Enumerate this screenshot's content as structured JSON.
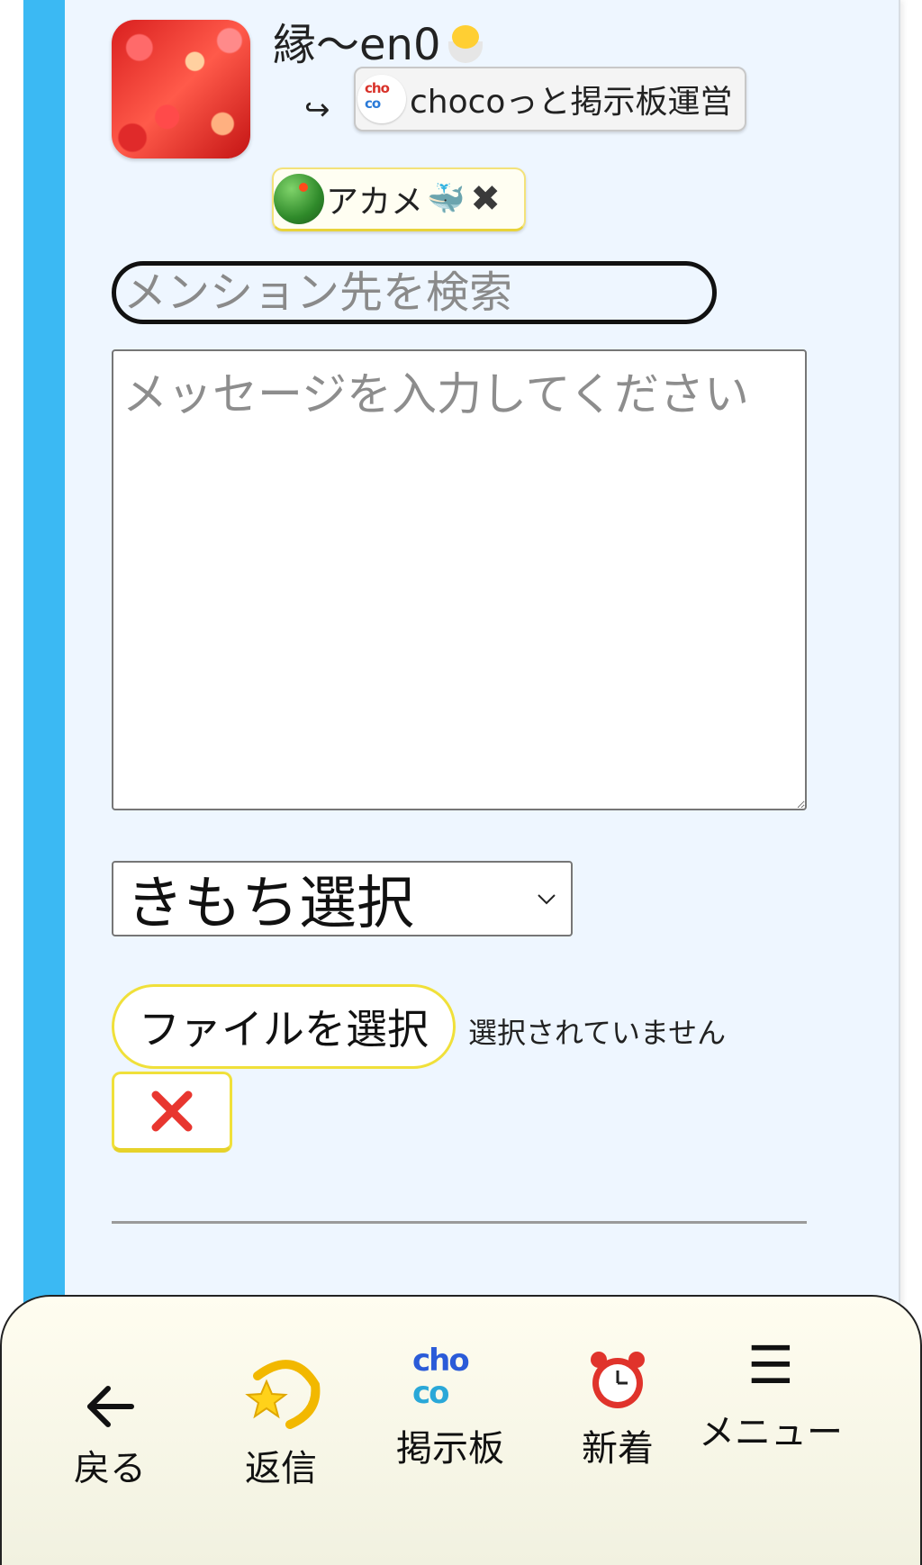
{
  "post": {
    "username": "縁〜en0",
    "reply_arrow": "↪",
    "reply_target_logo": [
      "cho",
      "co"
    ],
    "reply_target": "chocoっと掲示板運営"
  },
  "mention_chip": {
    "name": "アカメ",
    "whale": "🐳",
    "remove": "✖"
  },
  "form": {
    "mention_placeholder": "メンション先を検索",
    "message_placeholder": "メッセージを入力してください",
    "mood_select": "きもち選択",
    "file_button": "ファイルを選択",
    "file_status": "選択されていません",
    "clear_icon": "✕"
  },
  "bottom_nav": {
    "items": [
      {
        "label": "戻る",
        "icon": "arrow-left-icon"
      },
      {
        "label": "返信",
        "icon": "shooting-star-icon"
      },
      {
        "label": "掲示板",
        "icon": "choco-logo-icon",
        "logo": [
          "cho",
          "co"
        ]
      },
      {
        "label": "新着",
        "icon": "alarm-clock-icon"
      },
      {
        "label": "メニュー",
        "icon": "hamburger-icon",
        "glyph": "☰"
      }
    ]
  },
  "colors": {
    "accent_bar": "#3bb9f3",
    "panel_bg": "#eef6ff",
    "yellow_border": "#f0e03a",
    "clear_red": "#e8362f"
  }
}
